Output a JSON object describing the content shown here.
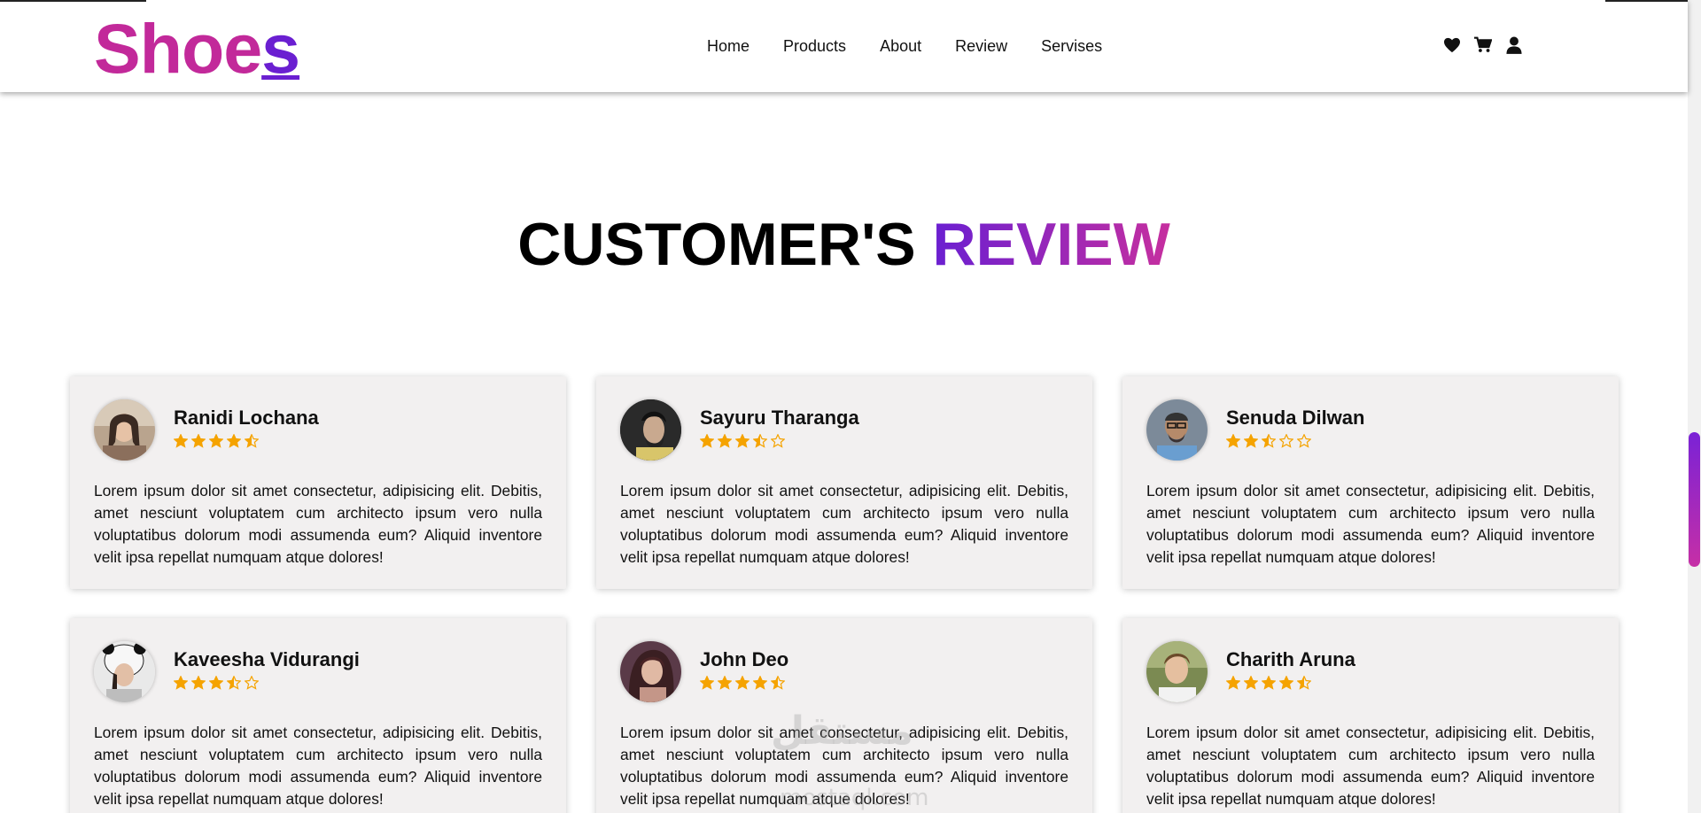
{
  "header": {
    "logo_main": "Shoe",
    "logo_accent": "s",
    "nav": [
      "Home",
      "Products",
      "About",
      "Review",
      "Servises"
    ],
    "icons": [
      "heart-icon",
      "cart-icon",
      "user-icon"
    ]
  },
  "section": {
    "title_black": "CUSTOMER'S",
    "title_gradient": "REVIEW"
  },
  "reviews": [
    {
      "name": "Ranidi Lochana",
      "rating": 4.5,
      "text": "Lorem ipsum dolor sit amet consectetur, adipisicing elit. Debitis, amet nesciunt voluptatem cum architecto ipsum vero nulla voluptatibus dolorum modi assumenda eum? Aliquid inventore velit ipsa repellat numquam atque dolores!"
    },
    {
      "name": "Sayuru Tharanga",
      "rating": 3.5,
      "text": "Lorem ipsum dolor sit amet consectetur, adipisicing elit. Debitis, amet nesciunt voluptatem cum architecto ipsum vero nulla voluptatibus dolorum modi assumenda eum? Aliquid inventore velit ipsa repellat numquam atque dolores!"
    },
    {
      "name": "Senuda Dilwan",
      "rating": 2.5,
      "text": "Lorem ipsum dolor sit amet consectetur, adipisicing elit. Debitis, amet nesciunt voluptatem cum architecto ipsum vero nulla voluptatibus dolorum modi assumenda eum? Aliquid inventore velit ipsa repellat numquam atque dolores!"
    },
    {
      "name": "Kaveesha Vidurangi",
      "rating": 3.5,
      "text": "Lorem ipsum dolor sit amet consectetur, adipisicing elit. Debitis, amet nesciunt voluptatem cum architecto ipsum vero nulla voluptatibus dolorum modi assumenda eum? Aliquid inventore velit ipsa repellat numquam atque dolores!"
    },
    {
      "name": "John Deo",
      "rating": 4.5,
      "text": "Lorem ipsum dolor sit amet consectetur, adipisicing elit. Debitis, amet nesciunt voluptatem cum architecto ipsum vero nulla voluptatibus dolorum modi assumenda eum? Aliquid inventore velit ipsa repellat numquam atque dolores!"
    },
    {
      "name": "Charith Aruna",
      "rating": 4.5,
      "text": "Lorem ipsum dolor sit amet consectetur, adipisicing elit. Debitis, amet nesciunt voluptatem cum architecto ipsum vero nulla voluptatibus dolorum modi assumenda eum? Aliquid inventore velit ipsa repellat numquam atque dolores!"
    }
  ],
  "colors": {
    "logo": "#c2299a",
    "logo_accent": "#6a1fd1",
    "gradient_start": "#6a1fd1",
    "gradient_end": "#c62f9f",
    "star": "#f5a300",
    "card_bg": "#f2f0f0"
  },
  "watermark": "مستقل",
  "watermark_sub": "mostaql.com"
}
